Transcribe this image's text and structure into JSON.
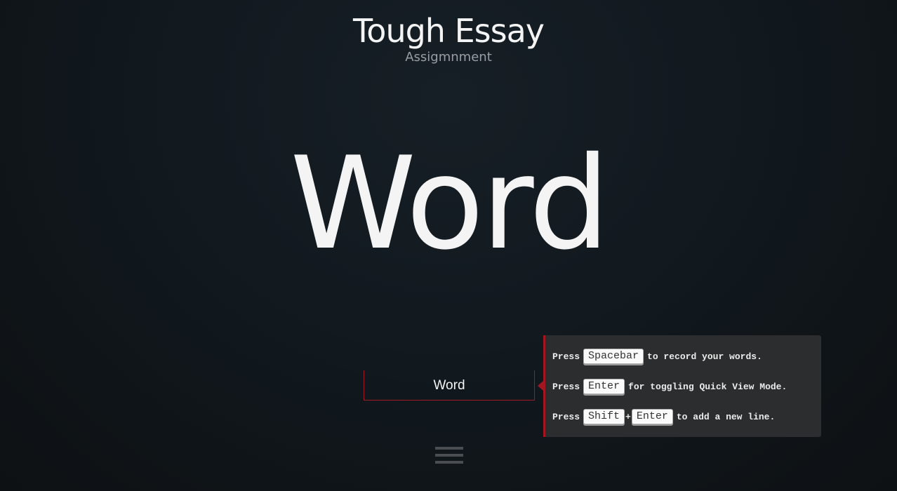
{
  "header": {
    "title": "Tough Essay",
    "subtitle": "Assigmnment"
  },
  "display": {
    "current_word": "Word"
  },
  "input": {
    "value": "Word"
  },
  "help": {
    "line1": {
      "prefix": "Press",
      "key": "Spacebar",
      "suffix": "to record your words."
    },
    "line2": {
      "prefix": "Press",
      "key": "Enter",
      "suffix": "for toggling Quick View Mode."
    },
    "line3": {
      "prefix": "Press",
      "key1": "Shift",
      "plus": "+",
      "key2": "Enter",
      "suffix": "to add a new line."
    }
  },
  "menu": {
    "icon": "hamburger-menu-icon"
  },
  "colors": {
    "background": "#121a20",
    "accent": "#a3151f",
    "tooltip_bg": "#2c2d2e",
    "text": "#f4f4f4",
    "subtitle": "#9a9ea2"
  }
}
